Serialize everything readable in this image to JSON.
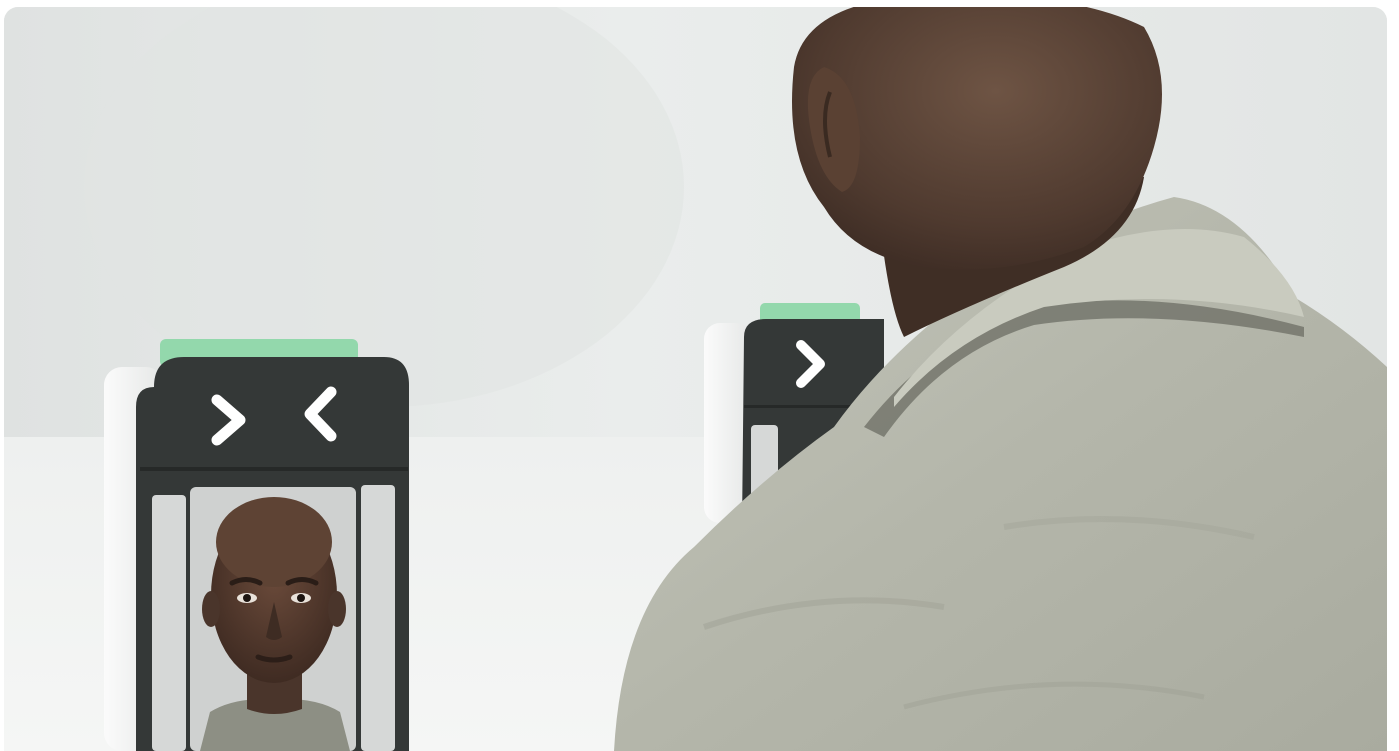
{
  "image": {
    "kind": "photograph",
    "subject_icons": [
      "face-scan-kiosk",
      "person",
      "chevron-right-icon",
      "chevron-left-icon"
    ]
  },
  "colors": {
    "wall": "#e6e9e8",
    "kiosk_dark": "#333736",
    "kiosk_white": "#f2f3f2",
    "status_light": "#8fd6a8",
    "jacket": "#b7b9ad",
    "skin": "#5a4337",
    "screen_bg": "#cfd1d0"
  }
}
